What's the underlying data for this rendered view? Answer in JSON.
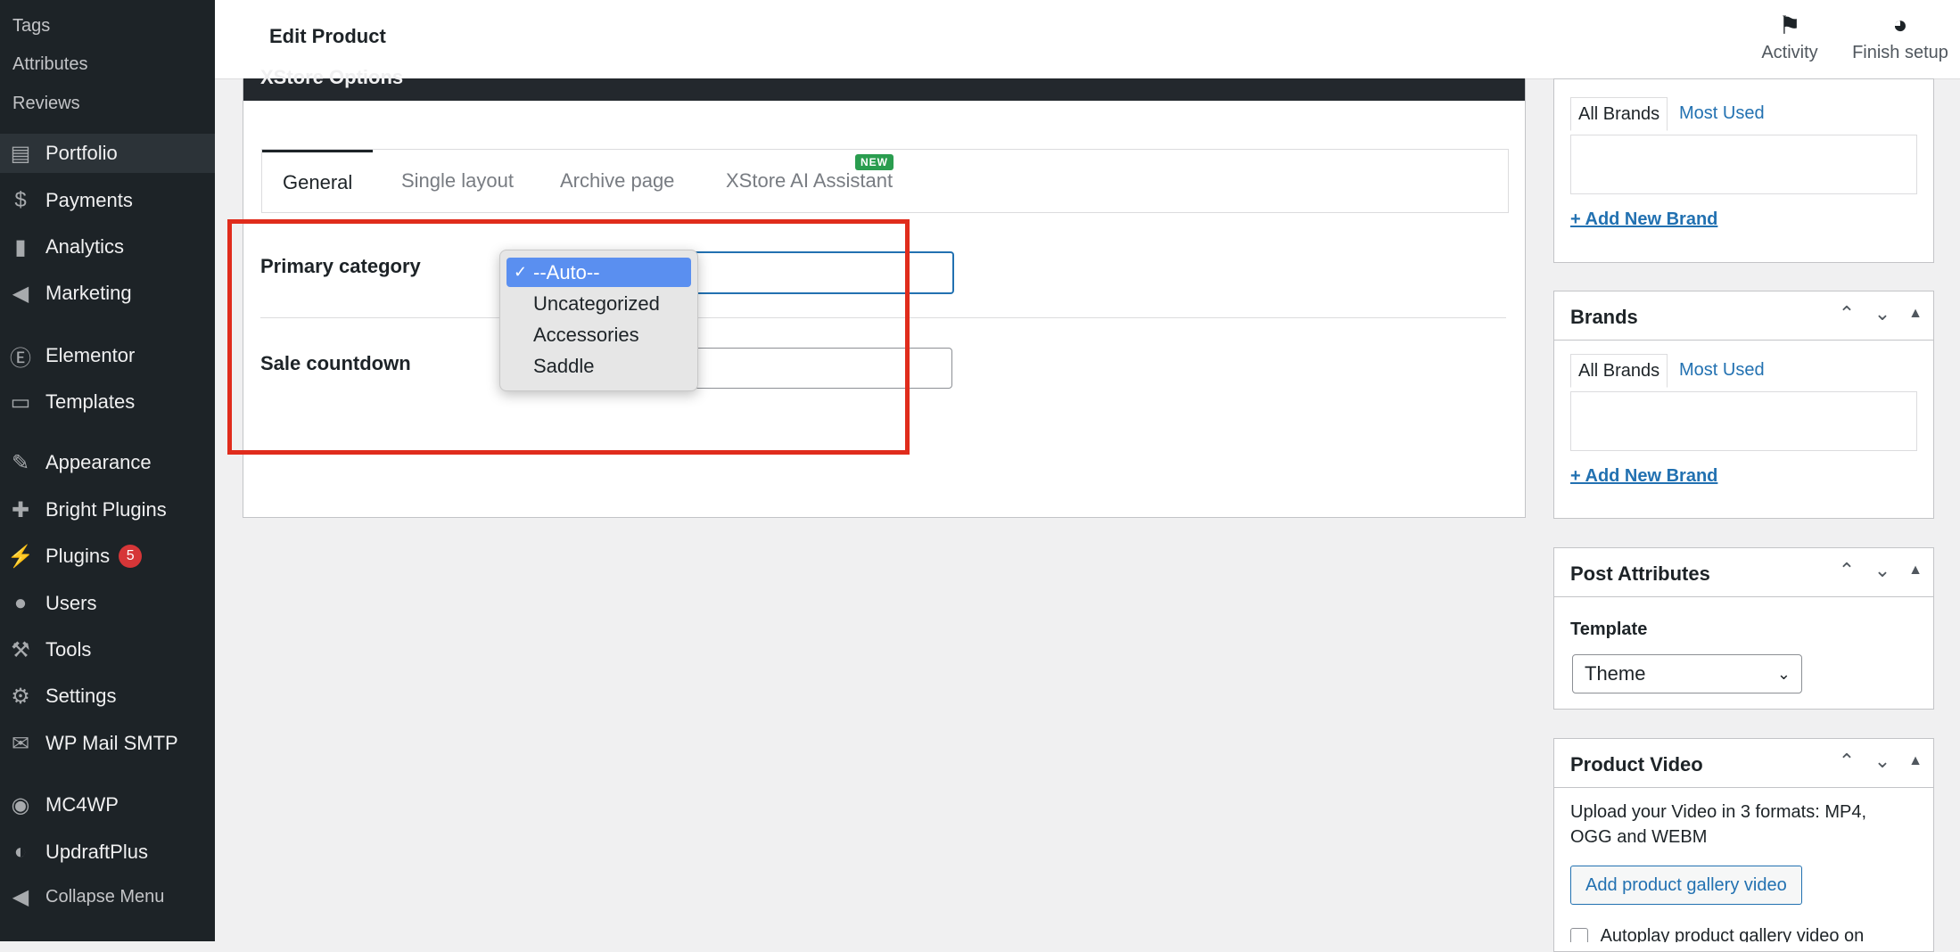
{
  "sidebar": {
    "sub_items": [
      "Tags",
      "Attributes",
      "Reviews"
    ],
    "items": [
      {
        "label": "Portfolio",
        "icon": "portfolio-icon"
      },
      {
        "label": "Payments",
        "icon": "payments-icon"
      },
      {
        "label": "Analytics",
        "icon": "analytics-icon"
      },
      {
        "label": "Marketing",
        "icon": "megaphone-icon"
      },
      {
        "label": "Elementor",
        "icon": "elementor-icon"
      },
      {
        "label": "Templates",
        "icon": "folder-icon"
      },
      {
        "label": "Appearance",
        "icon": "paintbrush-icon"
      },
      {
        "label": "Bright Plugins",
        "icon": "puzzle-icon"
      },
      {
        "label": "Plugins",
        "icon": "plug-icon",
        "badge": "5"
      },
      {
        "label": "Users",
        "icon": "user-icon"
      },
      {
        "label": "Tools",
        "icon": "wrench-icon"
      },
      {
        "label": "Settings",
        "icon": "settings-icon"
      },
      {
        "label": "WP Mail SMTP",
        "icon": "mail-icon"
      },
      {
        "label": "MC4WP",
        "icon": "mc4wp-icon"
      },
      {
        "label": "UpdraftPlus",
        "icon": "updraft-icon"
      },
      {
        "label": "Collapse Menu",
        "icon": "collapse-icon"
      }
    ]
  },
  "header": {
    "title": "Edit Product",
    "activity_label": "Activity",
    "finish_setup_label": "Finish setup"
  },
  "xstore": {
    "title": "XStore Options",
    "tabs": [
      "General",
      "Single layout",
      "Archive page",
      "XStore AI Assistant"
    ],
    "new_badge": "NEW",
    "primary_category_label": "Primary category",
    "sale_countdown_label": "Sale countdown",
    "dropdown": {
      "options": [
        "--Auto--",
        "Uncategorized",
        "Accessories",
        "Saddle"
      ],
      "selected": "--Auto--"
    }
  },
  "right": {
    "brands_top": {
      "tab_all": "All Brands",
      "tab_most": "Most Used",
      "add_link": "+ Add New Brand"
    },
    "brands": {
      "title": "Brands",
      "tab_all": "All Brands",
      "tab_most": "Most Used",
      "add_link": "+ Add New Brand"
    },
    "post_attributes": {
      "title": "Post Attributes",
      "template_label": "Template",
      "template_value": "Theme"
    },
    "product_video": {
      "title": "Product Video",
      "description": "Upload your Video in 3 formats: MP4, OGG and WEBM",
      "button": "Add product gallery video",
      "autoplay_label": "Autoplay product gallery video on"
    }
  },
  "colors": {
    "sidebar_bg": "#1d2327",
    "accent": "#2271b1",
    "highlight_box": "#e02c1c",
    "selected_option": "#5a8ff0"
  }
}
